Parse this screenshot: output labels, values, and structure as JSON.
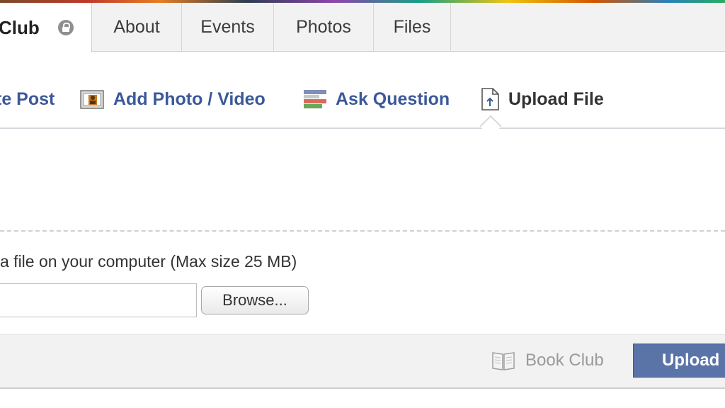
{
  "group": {
    "name_visible": "Club"
  },
  "tabs": [
    {
      "label": "About"
    },
    {
      "label": "Events"
    },
    {
      "label": "Photos"
    },
    {
      "label": "Files"
    }
  ],
  "composer": {
    "actions": [
      {
        "label": "te Post",
        "icon": "write-post-icon"
      },
      {
        "label": "Add Photo / Video",
        "icon": "photo-video-icon"
      },
      {
        "label": "Ask Question",
        "icon": "question-icon"
      },
      {
        "label": "Upload File",
        "icon": "upload-file-icon",
        "selected": true
      }
    ],
    "instruction": "a file on your computer (Max size 25 MB)",
    "file_input_value": "",
    "browse_label": "Browse..."
  },
  "footer": {
    "audience_label": "Book Club",
    "audience_icon": "book-icon",
    "upload_label": "Upload"
  },
  "colors": {
    "link_blue": "#3b5998",
    "button_blue": "#5b74a8",
    "bar_gray": "#f2f2f2"
  }
}
